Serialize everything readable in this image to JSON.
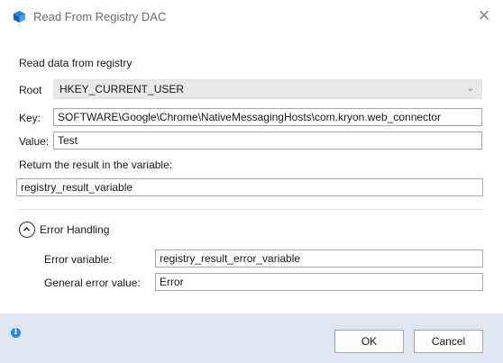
{
  "window": {
    "title": "Read From Registry DAC",
    "close_glyph": "✕",
    "icon": "cube-icon",
    "accent": "#2a8be6"
  },
  "section": {
    "heading": "Read data from registry"
  },
  "form": {
    "root_label": "Root",
    "root_value": "HKEY_CURRENT_USER",
    "root_chevron": "⌄",
    "key_label": "Key:",
    "key_value": "SOFTWARE\\Google\\Chrome\\NativeMessagingHosts\\com.kryon.web_connector",
    "value_label": "Value:",
    "value_value": "Test",
    "result_label": "Return the result in the variable:",
    "result_value": "registry_result_variable"
  },
  "error_handling": {
    "title": "Error Handling",
    "error_variable_label": "Error variable:",
    "error_variable_value": "registry_result_error_variable",
    "general_error_label": "General error value:",
    "general_error_value": "Error"
  },
  "footer": {
    "info_glyph": "i",
    "ok_label": "OK",
    "cancel_label": "Cancel",
    "background": "#dfe6f1"
  }
}
